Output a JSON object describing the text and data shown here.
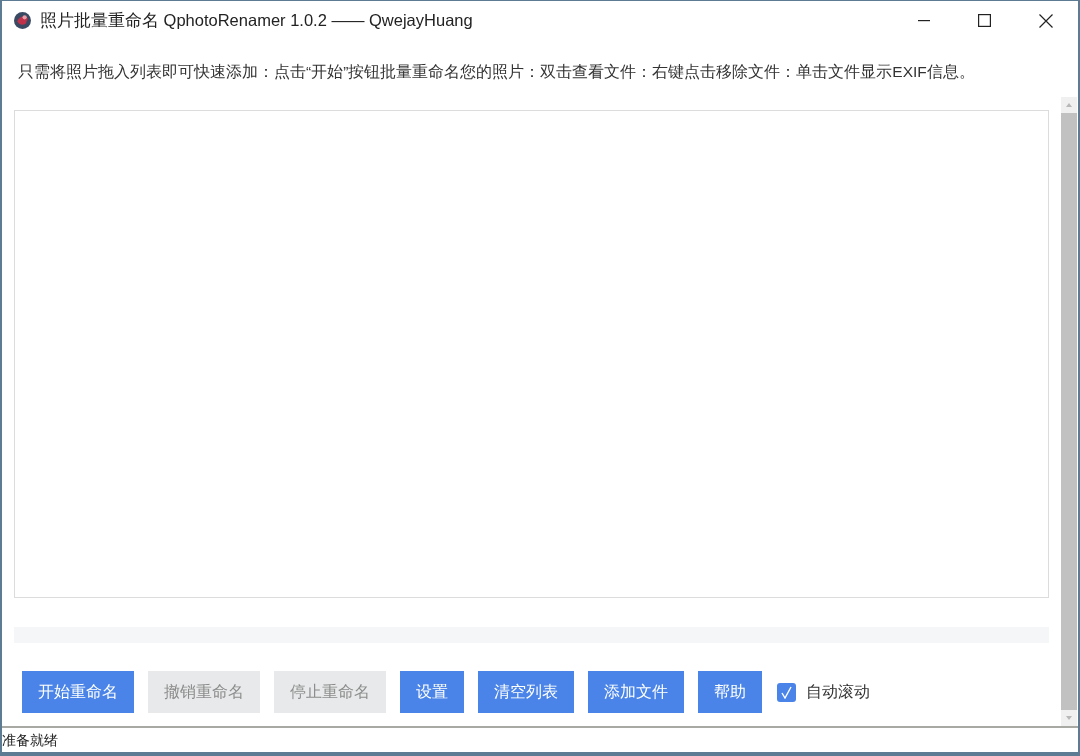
{
  "window": {
    "title": "照片批量重命名 QphotoRenamer 1.0.2 —— QwejayHuang"
  },
  "instructions": "只需将照片拖入列表即可快速添加：点击“开始”按钮批量重命名您的照片：双击查看文件：右键点击移除文件：单击文件显示EXIF信息。",
  "progress": {
    "level": 0
  },
  "buttons": [
    {
      "label": "开始重命名",
      "disabled": false
    },
    {
      "label": "撤销重命名",
      "disabled": true
    },
    {
      "label": "停止重命名",
      "disabled": true
    },
    {
      "label": "设置",
      "disabled": false
    },
    {
      "label": "清空列表",
      "disabled": false
    },
    {
      "label": "添加文件",
      "disabled": false
    },
    {
      "label": "帮助",
      "disabled": false
    }
  ],
  "auto_scroll": {
    "label": "自动滚动",
    "checked": true
  },
  "status_bar": {
    "text": "准备就绪"
  }
}
